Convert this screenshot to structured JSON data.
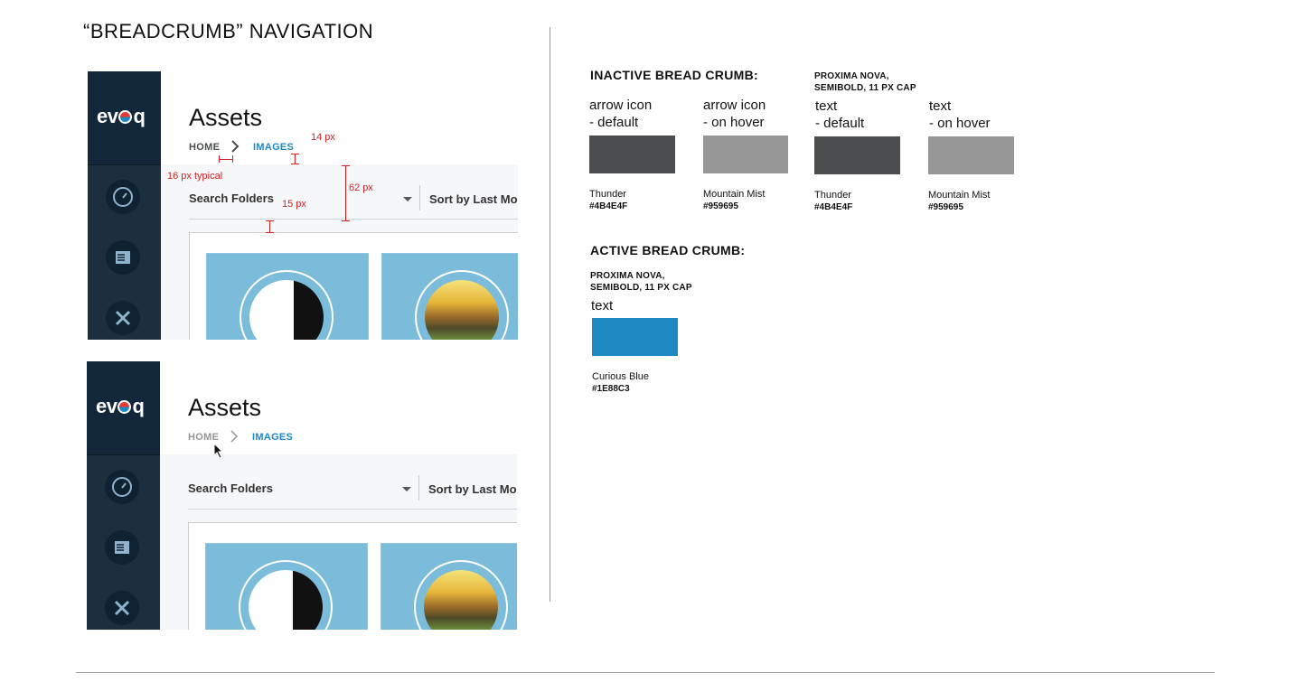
{
  "page_title": "“BREADCRUMB” NAVIGATION",
  "mockups": [
    {
      "logo": "evoq",
      "assets_title": "Assets",
      "crumb_home": "HOME",
      "crumb_images": "IMAGES",
      "home_color": "#4B4E4F",
      "arrow_color": "#4B4E4F",
      "search_label": "Search Folders",
      "sort_label": "Sort by Last Mo"
    },
    {
      "logo": "evoq",
      "assets_title": "Assets",
      "crumb_home": "HOME",
      "crumb_images": "IMAGES",
      "home_color": "#959695",
      "arrow_color": "#959695",
      "search_label": "Search Folders",
      "sort_label": "Sort by Last Mo"
    }
  ],
  "annotations": {
    "spacing_16": "16 px typical",
    "spacing_14": "14 px",
    "spacing_62": "62 px",
    "spacing_15": "15 px"
  },
  "inactive": {
    "heading": "INACTIVE BREAD CRUMB:",
    "font_note_line1": "PROXIMA NOVA,",
    "font_note_line2": "SEMIBOLD, 11 PX CAP",
    "swatches": [
      {
        "label1": "arrow icon",
        "label2": "- default",
        "color_name": "Thunder",
        "hex": "#4B4E4F",
        "color": "#4B4E4F"
      },
      {
        "label1": "arrow icon",
        "label2": "- on hover",
        "color_name": "Mountain Mist",
        "hex": "#959695",
        "color": "#959695"
      },
      {
        "label1": "text",
        "label2": "- default",
        "color_name": "Thunder",
        "hex": "#4B4E4F",
        "color": "#4B4E4F"
      },
      {
        "label1": "text",
        "label2": "- on hover",
        "color_name": "Mountain Mist",
        "hex": "#959695",
        "color": "#959695"
      }
    ]
  },
  "active": {
    "heading": "ACTIVE BREAD CRUMB:",
    "font_note_line1": "PROXIMA NOVA,",
    "font_note_line2": "SEMIBOLD, 11 PX CAP",
    "label": "text",
    "color_name": "Curious Blue",
    "hex": "#1E88C3",
    "color": "#1E88C3"
  }
}
